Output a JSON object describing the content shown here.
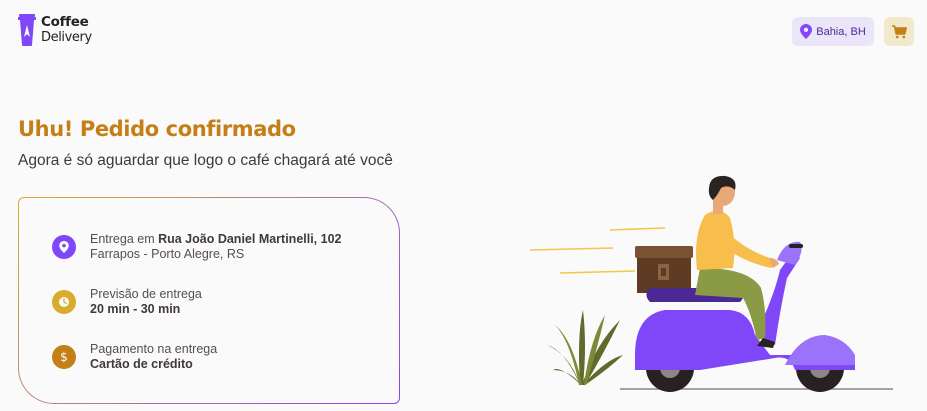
{
  "header": {
    "logo": {
      "line1": "Coffee",
      "line2": "Delivery"
    },
    "location": {
      "label": "Bahia, BH",
      "icon": "map-pin-icon"
    },
    "cart": {
      "icon": "shopping-cart-icon"
    }
  },
  "main": {
    "title": "Uhu! Pedido confirmado",
    "subtitle": "Agora é só aguardar que logo o café chagará até você"
  },
  "info": {
    "address": {
      "icon": "map-pin-icon",
      "prefix": "Entrega em ",
      "street": "Rua João Daniel Martinelli, 102",
      "district": "Farrapos - Porto Alegre, RS"
    },
    "forecast": {
      "icon": "timer-icon",
      "label": "Previsão de entrega",
      "value": "20 min - 30 min"
    },
    "payment": {
      "icon": "currency-dollar-icon",
      "label": "Pagamento na entrega",
      "value": "Cartão de crédito"
    }
  },
  "colors": {
    "yellow_dark": "#C47F17",
    "yellow": "#DBAC2C",
    "purple": "#8047F8",
    "purple_dark": "#4B2995",
    "purple_light": "#EBE5F9",
    "yellow_light": "#F1E9C9",
    "background": "#FAFAFA"
  }
}
